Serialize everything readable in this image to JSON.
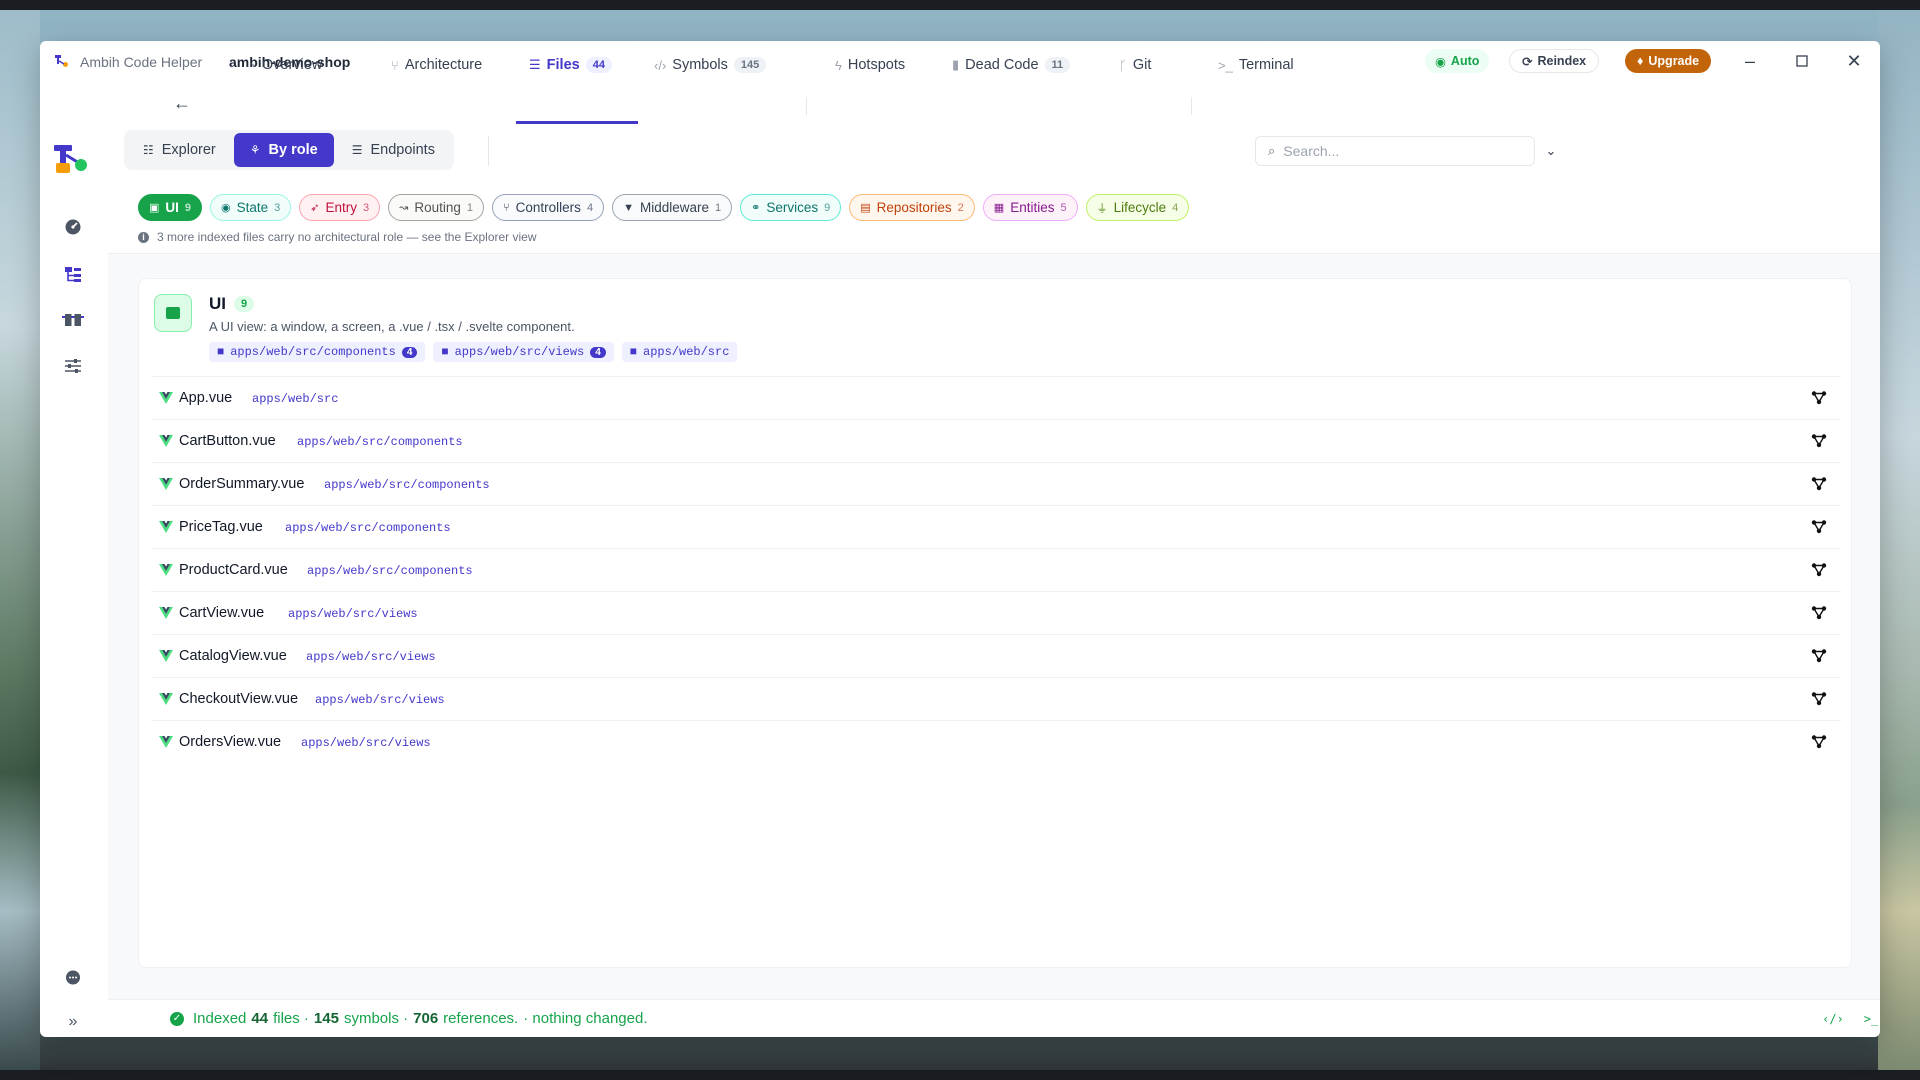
{
  "titlebar": {
    "app_name": "Ambih Code Helper",
    "project": "ambih-demo-shop",
    "auto_label": "Auto",
    "reindex_label": "Reindex",
    "upgrade_label": "Upgrade"
  },
  "nav": {
    "tabs": [
      {
        "label": "Overview",
        "icon": "overview-icon"
      },
      {
        "label": "Architecture",
        "icon": "architecture-icon"
      },
      {
        "label": "Files",
        "count": "44",
        "icon": "files-icon",
        "active": true
      },
      {
        "label": "Symbols",
        "count": "145",
        "icon": "code-icon"
      },
      {
        "label": "Hotspots",
        "icon": "lightning-icon"
      },
      {
        "label": "Dead Code",
        "count": "11",
        "icon": "tombstone-icon"
      },
      {
        "label": "Git",
        "icon": "git-branch-icon"
      },
      {
        "label": "Terminal",
        "icon": "terminal-icon"
      }
    ]
  },
  "view_modes": [
    {
      "label": "Explorer"
    },
    {
      "label": "By role",
      "active": true
    },
    {
      "label": "Endpoints"
    }
  ],
  "search": {
    "placeholder": "Search..."
  },
  "roles": [
    {
      "label": "UI",
      "count": "9",
      "color": "#16a34a",
      "active": true
    },
    {
      "label": "State",
      "count": "3",
      "color": "#14b8a6"
    },
    {
      "label": "Entry",
      "count": "3",
      "color": "#e11d48"
    },
    {
      "label": "Routing",
      "count": "1",
      "color": "#78716c"
    },
    {
      "label": "Controllers",
      "count": "4",
      "color": "#475569"
    },
    {
      "label": "Middleware",
      "count": "1",
      "color": "#4b5563"
    },
    {
      "label": "Services",
      "count": "9",
      "color": "#0d9488"
    },
    {
      "label": "Repositories",
      "count": "2",
      "color": "#ea580c"
    },
    {
      "label": "Entities",
      "count": "5",
      "color": "#9d174d"
    },
    {
      "label": "Lifecycle",
      "count": "4",
      "color": "#65a30d"
    }
  ],
  "info_note": "3 more indexed files carry no architectural role — see the Explorer view",
  "group": {
    "title": "UI",
    "count": "9",
    "description": "A UI view: a window, a screen, a .vue / .tsx / .svelte component.",
    "paths": [
      {
        "path": "apps/web/src/components",
        "count": "4"
      },
      {
        "path": "apps/web/src/views",
        "count": "4"
      },
      {
        "path": "apps/web/src",
        "count": ""
      }
    ],
    "files": [
      {
        "name": "App.vue",
        "path": "apps/web/src"
      },
      {
        "name": "CartButton.vue",
        "path": "apps/web/src/components"
      },
      {
        "name": "OrderSummary.vue",
        "path": "apps/web/src/components"
      },
      {
        "name": "PriceTag.vue",
        "path": "apps/web/src/components"
      },
      {
        "name": "ProductCard.vue",
        "path": "apps/web/src/components"
      },
      {
        "name": "CartView.vue",
        "path": "apps/web/src/views"
      },
      {
        "name": "CatalogView.vue",
        "path": "apps/web/src/views"
      },
      {
        "name": "CheckoutView.vue",
        "path": "apps/web/src/views"
      },
      {
        "name": "OrdersView.vue",
        "path": "apps/web/src/views"
      }
    ]
  },
  "status": {
    "prefix": "Indexed",
    "files": "44",
    "files_label": "files ·",
    "symbols": "145",
    "symbols_label": "symbols ·",
    "references": "706",
    "references_label": "references.",
    "suffix": "· nothing changed."
  },
  "colors": {
    "accent": "#4338ca",
    "success": "#16a34a",
    "upgrade": "#c2640a"
  }
}
